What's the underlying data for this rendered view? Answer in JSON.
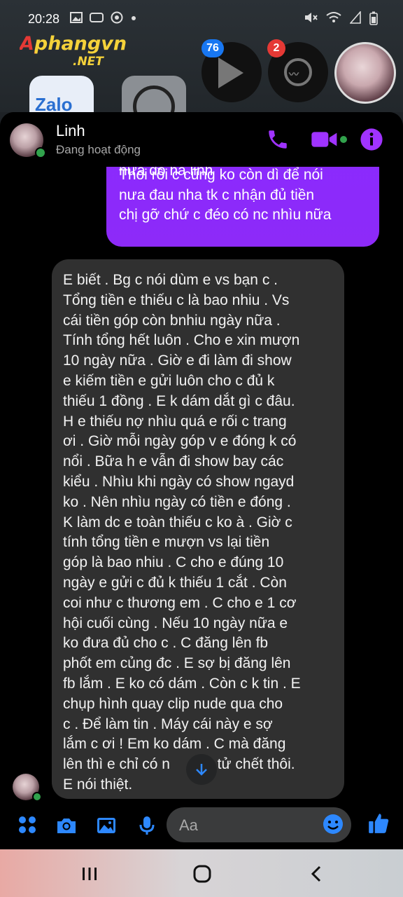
{
  "status_bar": {
    "time": "20:28",
    "left_icons": [
      "gallery-icon",
      "lof-icon",
      "chrome-icon",
      "dot-icon"
    ],
    "right_icons": [
      "mute-icon",
      "wifi-icon",
      "signal-icon",
      "battery-icon"
    ]
  },
  "watermark": {
    "main": "Aphangvn",
    "sub": ".NET"
  },
  "chat_heads": {
    "play_badge": "76",
    "messenger_badge": "2"
  },
  "home_apps": {
    "zalo": "Zalo"
  },
  "header": {
    "name": "Linh",
    "status": "Đang hoạt động"
  },
  "sent_message": {
    "lines": [
      "nưa đó hả linh",
      "Thoi rồi c cũng ko còn dì để nói",
      "nưa đau nha tk c nhận đủ tiền",
      "chị gỡ chứ c đéo có nc nhìu nữa"
    ]
  },
  "received_message": {
    "lines": [
      "E biết . Bg c nói dùm e vs bạn c .",
      "Tổng tiền e thiếu c là bao nhiu . Vs",
      "cái tiền góp còn bnhiu ngày nữa .",
      "Tính tổng hết luôn . Cho e xin mượn",
      "10 ngày nữa . Giờ e đi làm đi show",
      "e kiếm tiền e gửi luôn cho c đủ k",
      "thiếu 1 đồng . E k dám dắt gì c đâu.",
      "H e thiếu nợ nhìu quá e rối c trang",
      "ơi . Giờ mỗi ngày góp v e đóng k có",
      "nổi . Bữa h e vẫn đi show bay các",
      "kiểu . Nhìu khi ngày có show ngayd",
      "ko . Nên nhìu ngày có tiền e đóng .",
      "K làm dc e toàn thiếu c ko à . Giờ c",
      "tính tổng tiền e mượn vs lại tiền",
      "góp là bao nhiu . C cho e đúng 10",
      "ngày e gửi c đủ k thiếu 1 cắt . Còn",
      "coi như c thương em . C cho e 1 cơ",
      "hội cuối cùng . Nếu 10 ngày nữa e",
      "ko đưa đủ cho c . C đăng lên fb",
      "phốt em củng đc . E sợ bị đăng lên",
      "fb lắm . E ko có dám . Còn c k tin . E",
      "chụp hình quay clip nude qua cho",
      "c . Để làm tin . Máy cái này e sợ",
      "lắm c ơi ! Em ko dám . C mà đăng",
      "lên thì e chỉ có n",
      "E nói thiệt."
    ],
    "line_25_tail": "tự tử chết thôi."
  },
  "composer": {
    "placeholder": "Aa"
  },
  "colors": {
    "accent": "#2d88ff",
    "sent_bubble": "#8a2bff",
    "header_icons": "#a033ff",
    "received_bubble": "#303030",
    "online": "#31a24c"
  }
}
